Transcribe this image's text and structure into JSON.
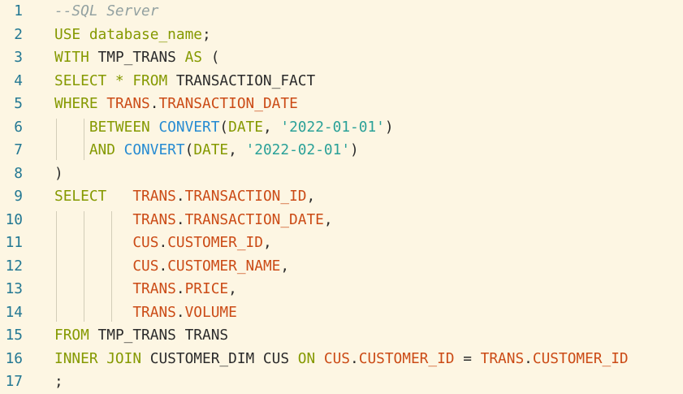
{
  "editor": {
    "language_comment": "--SQL Server",
    "lines": [
      {
        "num": "1",
        "tokens": [
          {
            "t": "--SQL Server",
            "c": "t-comment"
          }
        ]
      },
      {
        "num": "2",
        "tokens": [
          {
            "t": "USE database_name",
            "c": "t-kw"
          },
          {
            "t": ";",
            "c": "t-punct"
          }
        ]
      },
      {
        "num": "3",
        "tokens": [
          {
            "t": "WITH",
            "c": "t-kw"
          },
          {
            "t": " TMP_TRANS ",
            "c": "t-plain"
          },
          {
            "t": "AS",
            "c": "t-kw"
          },
          {
            "t": " (",
            "c": "t-punct"
          }
        ]
      },
      {
        "num": "4",
        "tokens": [
          {
            "t": "SELECT * FROM",
            "c": "t-kw"
          },
          {
            "t": " TRANSACTION_FACT",
            "c": "t-plain"
          }
        ]
      },
      {
        "num": "5",
        "tokens": [
          {
            "t": "WHERE",
            "c": "t-kw"
          },
          {
            "t": " TRANS",
            "c": "t-field"
          },
          {
            "t": ".",
            "c": "t-punct"
          },
          {
            "t": "TRANSACTION_DATE",
            "c": "t-field"
          }
        ]
      },
      {
        "num": "6",
        "tokens": [
          {
            "t": "    BETWEEN",
            "c": "t-kw"
          },
          {
            "t": " CONVERT",
            "c": "t-fn"
          },
          {
            "t": "(",
            "c": "t-punct"
          },
          {
            "t": "DATE",
            "c": "t-kw"
          },
          {
            "t": ", ",
            "c": "t-punct"
          },
          {
            "t": "'2022-01-01'",
            "c": "t-str"
          },
          {
            "t": ")",
            "c": "t-punct"
          }
        ]
      },
      {
        "num": "7",
        "tokens": [
          {
            "t": "    AND",
            "c": "t-kw"
          },
          {
            "t": " CONVERT",
            "c": "t-fn"
          },
          {
            "t": "(",
            "c": "t-punct"
          },
          {
            "t": "DATE",
            "c": "t-kw"
          },
          {
            "t": ", ",
            "c": "t-punct"
          },
          {
            "t": "'2022-02-01'",
            "c": "t-str"
          },
          {
            "t": ")",
            "c": "t-punct"
          }
        ]
      },
      {
        "num": "8",
        "tokens": [
          {
            "t": ")",
            "c": "t-punct"
          }
        ]
      },
      {
        "num": "9",
        "tokens": [
          {
            "t": "SELECT",
            "c": "t-kw"
          },
          {
            "t": "   TRANS",
            "c": "t-field"
          },
          {
            "t": ".",
            "c": "t-punct"
          },
          {
            "t": "TRANSACTION_ID",
            "c": "t-field"
          },
          {
            "t": ",",
            "c": "t-punct"
          }
        ]
      },
      {
        "num": "10",
        "tokens": [
          {
            "t": "         TRANS",
            "c": "t-field"
          },
          {
            "t": ".",
            "c": "t-punct"
          },
          {
            "t": "TRANSACTION_DATE",
            "c": "t-field"
          },
          {
            "t": ",",
            "c": "t-punct"
          }
        ]
      },
      {
        "num": "11",
        "tokens": [
          {
            "t": "         CUS",
            "c": "t-field"
          },
          {
            "t": ".",
            "c": "t-punct"
          },
          {
            "t": "CUSTOMER_ID",
            "c": "t-field"
          },
          {
            "t": ",",
            "c": "t-punct"
          }
        ]
      },
      {
        "num": "12",
        "tokens": [
          {
            "t": "         CUS",
            "c": "t-field"
          },
          {
            "t": ".",
            "c": "t-punct"
          },
          {
            "t": "CUSTOMER_NAME",
            "c": "t-field"
          },
          {
            "t": ",",
            "c": "t-punct"
          }
        ]
      },
      {
        "num": "13",
        "tokens": [
          {
            "t": "         TRANS",
            "c": "t-field"
          },
          {
            "t": ".",
            "c": "t-punct"
          },
          {
            "t": "PRICE",
            "c": "t-field"
          },
          {
            "t": ",",
            "c": "t-punct"
          }
        ]
      },
      {
        "num": "14",
        "tokens": [
          {
            "t": "         TRANS",
            "c": "t-field"
          },
          {
            "t": ".",
            "c": "t-punct"
          },
          {
            "t": "VOLUME",
            "c": "t-field"
          }
        ]
      },
      {
        "num": "15",
        "tokens": [
          {
            "t": "FROM",
            "c": "t-kw"
          },
          {
            "t": " TMP_TRANS TRANS",
            "c": "t-plain"
          }
        ]
      },
      {
        "num": "16",
        "tokens": [
          {
            "t": "INNER JOIN",
            "c": "t-kw"
          },
          {
            "t": " CUSTOMER_DIM CUS ",
            "c": "t-plain"
          },
          {
            "t": "ON",
            "c": "t-kw"
          },
          {
            "t": " CUS",
            "c": "t-field"
          },
          {
            "t": ".",
            "c": "t-punct"
          },
          {
            "t": "CUSTOMER_ID",
            "c": "t-field"
          },
          {
            "t": " = ",
            "c": "t-punct"
          },
          {
            "t": "TRANS",
            "c": "t-field"
          },
          {
            "t": ".",
            "c": "t-punct"
          },
          {
            "t": "CUSTOMER_ID",
            "c": "t-field"
          }
        ]
      },
      {
        "num": "17",
        "tokens": [
          {
            "t": ";",
            "c": "t-punct"
          }
        ]
      }
    ]
  },
  "colors": {
    "background": "#fdf6e3",
    "line_number": "#237893",
    "keyword": "#859900",
    "identifier": "#cb4b16",
    "function": "#268bd2",
    "string": "#2aa198",
    "comment": "#93a1a1"
  }
}
